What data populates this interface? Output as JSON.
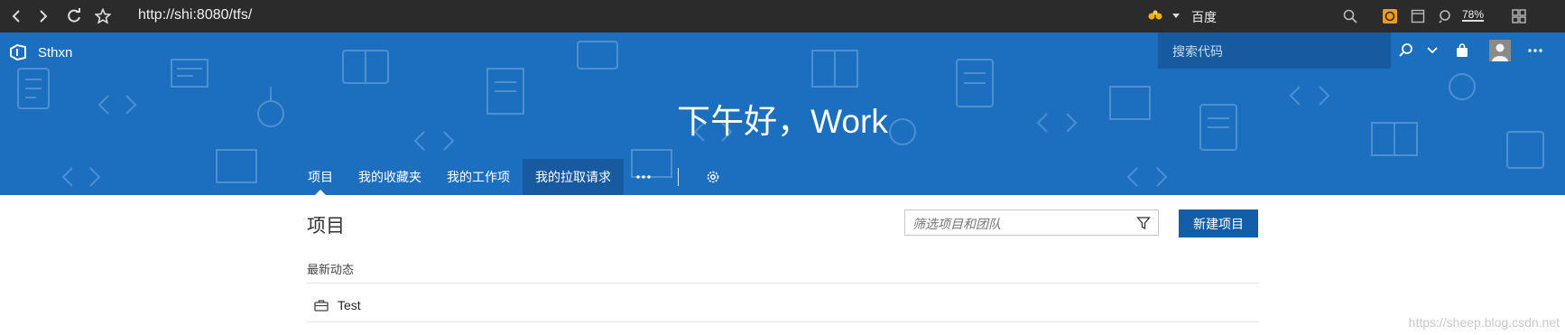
{
  "browser": {
    "url": "http://shi:8080/tfs/",
    "search_engine_label": "百度",
    "zoom_label": "78%",
    "icons": [
      "back-icon",
      "forward-icon",
      "refresh-icon",
      "bookmark-star-icon",
      "search-engine-icon",
      "dropdown-icon",
      "search-icon",
      "extension-icon",
      "reader-icon",
      "find-icon",
      "grid-icon"
    ]
  },
  "header": {
    "org_name": "Sthxn",
    "search_placeholder": "搜索代码"
  },
  "hero": {
    "greeting": "下午好，Work",
    "background_color": "#1c6fbf"
  },
  "tabs": [
    {
      "label": "项目",
      "selected": true
    },
    {
      "label": "我的收藏夹"
    },
    {
      "label": "我的工作项"
    },
    {
      "label": "我的拉取请求",
      "highlighted": true
    }
  ],
  "main": {
    "title": "项目",
    "filter_placeholder": "筛选项目和团队",
    "new_project_label": "新建项目",
    "recent_label": "最新动态",
    "projects": [
      {
        "name": "Test"
      }
    ]
  },
  "watermark": "https://sheep.blog.csdn.net"
}
